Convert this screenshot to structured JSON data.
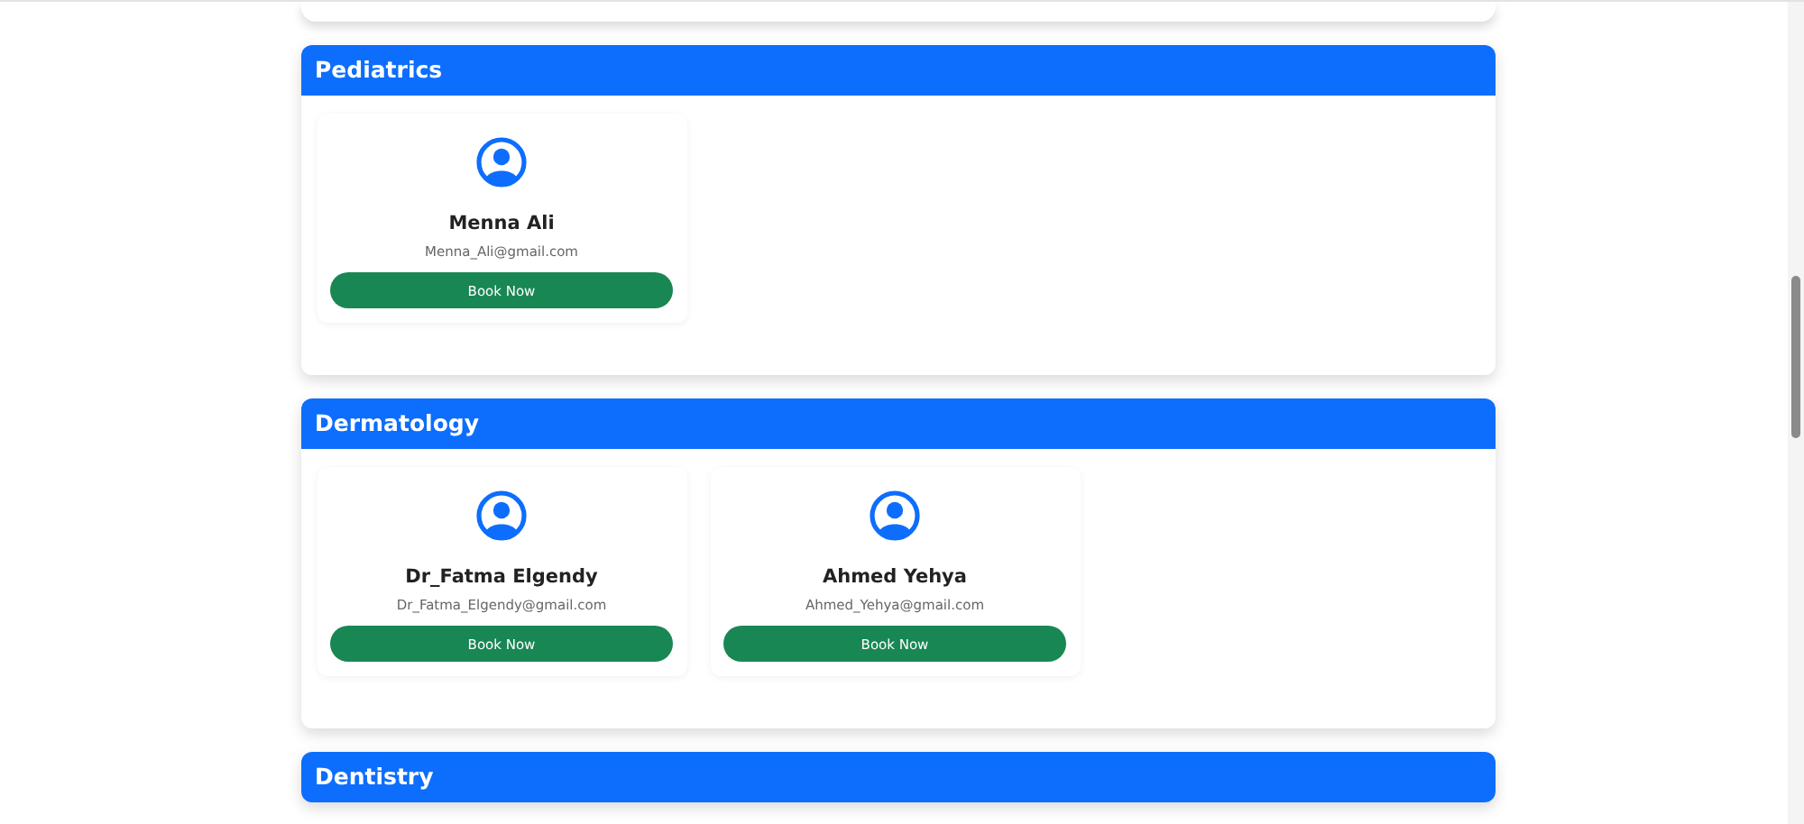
{
  "sections": [
    {
      "title": "Pediatrics",
      "doctors": [
        {
          "name": "Menna Ali",
          "email": "Menna_Ali@gmail.com",
          "button": "Book Now"
        }
      ]
    },
    {
      "title": "Dermatology",
      "doctors": [
        {
          "name": "Dr_Fatma Elgendy",
          "email": "Dr_Fatma_Elgendy@gmail.com",
          "button": "Book Now"
        },
        {
          "name": "Ahmed Yehya",
          "email": "Ahmed_Yehya@gmail.com",
          "button": "Book Now"
        }
      ]
    },
    {
      "title": "Dentistry"
    }
  ]
}
